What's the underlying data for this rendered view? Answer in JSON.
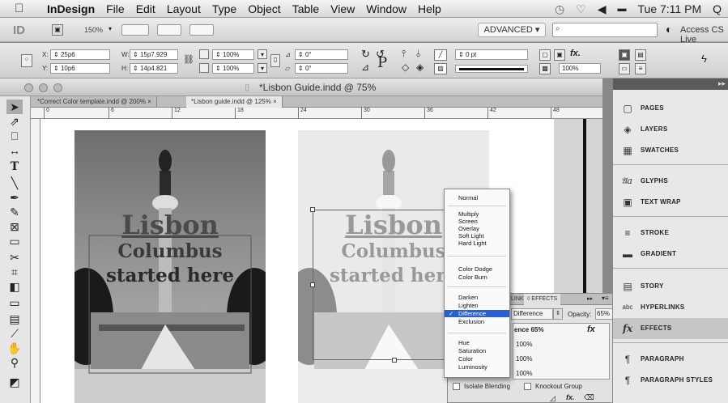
{
  "menubar": {
    "app": "InDesign",
    "items": [
      "File",
      "Edit",
      "Layout",
      "Type",
      "Object",
      "Table",
      "View",
      "Window",
      "Help"
    ],
    "clock": "Tue 7:11 PM"
  },
  "appbar": {
    "logo": "ID",
    "zoom": "150%",
    "workspace": "ADVANCED",
    "search_placeholder": "",
    "cs_live": "Access CS Live"
  },
  "control": {
    "x": "25p6",
    "y": "10p6",
    "w": "15p7.929",
    "h": "14p4.821",
    "scale_x": "100%",
    "scale_y": "100%",
    "rotate": "0°",
    "shear": "0°",
    "stroke_weight": "0 pt",
    "opacity": "100%"
  },
  "document": {
    "window_title": "*Lisbon Guide.indd @ 75%",
    "tabs": [
      {
        "label": "*Correct Color template.indd @ 200%"
      },
      {
        "label": "*Lisbon guide.indd @ 125%"
      }
    ],
    "ruler_ticks": [
      "0",
      "6",
      "12",
      "18",
      "24",
      "30",
      "36",
      "42",
      "48"
    ]
  },
  "photo": {
    "line1": "Lisbon",
    "line2": "Columbus",
    "line3": "started here"
  },
  "blend_menu": {
    "groups": [
      [
        "Normal"
      ],
      [
        "Multiply",
        "Screen",
        "Overlay",
        "Soft Light",
        "Hard Light"
      ],
      [
        "Color Dodge",
        "Color Burn"
      ],
      [
        "Darken",
        "Lighten",
        "Difference",
        "Exclusion"
      ],
      [
        "Hue",
        "Saturation",
        "Color",
        "Luminosity"
      ]
    ],
    "selected": "Difference"
  },
  "effects_panel": {
    "tab_links": "LINK",
    "tab_effects": "EFFECTS",
    "blend_value": "Difference",
    "opacity_label": "Opacity:",
    "opacity_value": "65%",
    "rows": [
      {
        "label": "ence 65%"
      },
      {
        "label": "100%"
      },
      {
        "label": "100%"
      },
      {
        "label": "100%"
      }
    ],
    "isolate": "Isolate Blending",
    "knockout": "Knockout Group"
  },
  "dock": {
    "items": [
      {
        "label": "PAGES",
        "icon": "pages-icon",
        "glyph": "▢"
      },
      {
        "label": "LAYERS",
        "icon": "layers-icon",
        "glyph": "◈"
      },
      {
        "label": "SWATCHES",
        "icon": "swatches-icon",
        "glyph": "▦"
      },
      {
        "label": "GLYPHS",
        "icon": "glyphs-icon",
        "glyph": "𝔄a"
      },
      {
        "label": "TEXT WRAP",
        "icon": "text-wrap-icon",
        "glyph": "▣"
      },
      {
        "label": "STROKE",
        "icon": "stroke-icon",
        "glyph": "≡"
      },
      {
        "label": "GRADIENT",
        "icon": "gradient-icon",
        "glyph": "▬"
      },
      {
        "label": "STORY",
        "icon": "story-icon",
        "glyph": "▤"
      },
      {
        "label": "HYPERLINKS",
        "icon": "hyperlinks-icon",
        "glyph": "abc"
      },
      {
        "label": "EFFECTS",
        "icon": "effects-icon",
        "glyph": "fx"
      },
      {
        "label": "PARAGRAPH",
        "icon": "paragraph-icon",
        "glyph": "¶"
      },
      {
        "label": "PARAGRAPH STYLES",
        "icon": "paragraph-styles-icon",
        "glyph": "¶"
      }
    ]
  }
}
